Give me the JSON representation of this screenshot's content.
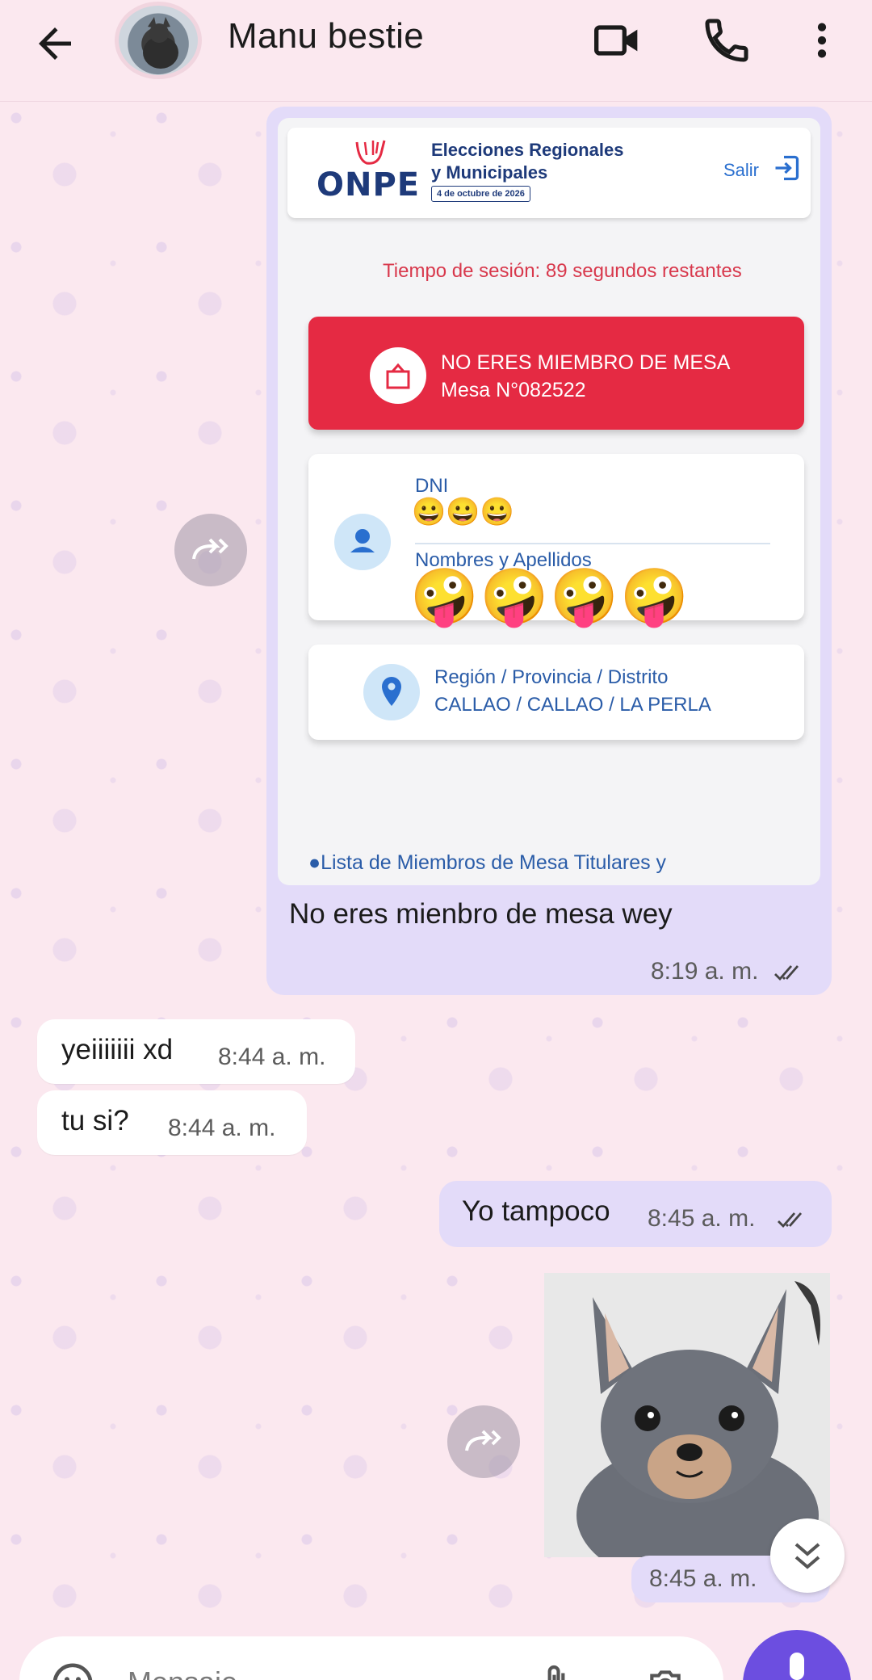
{
  "header": {
    "contact_name": "Manu bestie",
    "icons": [
      "back-arrow-icon",
      "video-call-icon",
      "phone-call-icon",
      "more-vert-icon"
    ]
  },
  "onpe": {
    "logo": "ONPE",
    "event_line1": "Elecciones Regionales",
    "event_line2": "y Municipales",
    "date": "4 de octubre de 2026",
    "exit_label": "Salir",
    "session_text": "Tiempo de sesión: 89 segundos restantes",
    "mesa_line1": "NO ERES MIEMBRO DE MESA",
    "mesa_line2": "Mesa N°082522",
    "dni_label": "DNI",
    "dni_emoji": "😀😀😀",
    "names_label": "Nombres y Apellidos",
    "names_emoji": "🤪🤪🤪🤪",
    "region_label": "Región / Provincia / Distrito",
    "region_value": "CALLAO / CALLAO / LA PERLA",
    "list_text": "●Lista de Miembros de Mesa Titulares y"
  },
  "messages": [
    {
      "direction": "out",
      "text": "No eres mienbro de mesa wey",
      "time": "8:19 a. m."
    },
    {
      "direction": "in",
      "text": "yeiiiiiii xd",
      "time": "8:44 a. m."
    },
    {
      "direction": "in",
      "text": "tu si?",
      "time": "8:44 a. m."
    },
    {
      "direction": "out",
      "text": "Yo tampoco",
      "time": "8:45 a. m."
    },
    {
      "direction": "out",
      "text": "",
      "time": "8:45 a. m."
    }
  ],
  "input": {
    "placeholder": "Mensaje"
  },
  "colors": {
    "background": "#fbe8ef",
    "outgoing_bubble": "#e3dbf9",
    "incoming_bubble": "#ffffff",
    "accent": "#6c4ee0",
    "onpe_red": "#e52a43",
    "onpe_blue": "#2a5ca8"
  }
}
